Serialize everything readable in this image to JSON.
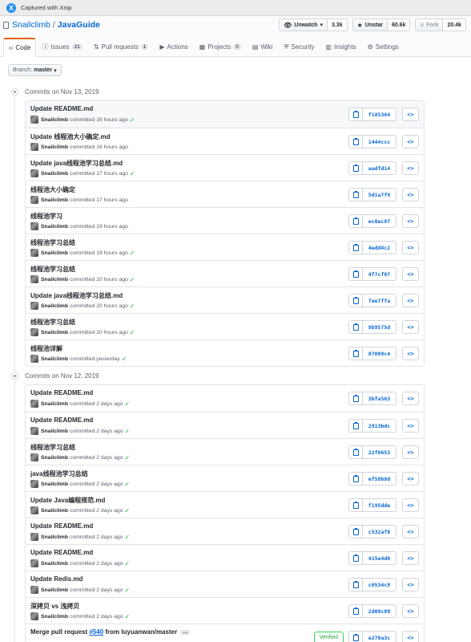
{
  "xnip": {
    "text": "Captured with Xnip",
    "logo": "X"
  },
  "repo": {
    "owner": "Snailclimb",
    "separator": "/",
    "name": "JavaGuide"
  },
  "actions": {
    "watch": {
      "label": "Unwatch",
      "count": "3.3k"
    },
    "star": {
      "label": "Unstar",
      "count": "60.6k"
    },
    "fork": {
      "label": "Fork",
      "count": "20.4k"
    }
  },
  "tabs": [
    {
      "label": "Code",
      "icon": "code-icon"
    },
    {
      "label": "Issues",
      "count": "21",
      "icon": "issue-icon"
    },
    {
      "label": "Pull requests",
      "count": "1",
      "icon": "pull-request-icon"
    },
    {
      "label": "Actions",
      "icon": "play-icon"
    },
    {
      "label": "Projects",
      "count": "0",
      "icon": "project-icon"
    },
    {
      "label": "Wiki",
      "icon": "book-icon"
    },
    {
      "label": "Security",
      "icon": "shield-icon"
    },
    {
      "label": "Insights",
      "icon": "graph-icon"
    },
    {
      "label": "Settings",
      "icon": "gear-icon"
    }
  ],
  "branch": {
    "label": "Branch:",
    "value": "master"
  },
  "groups": [
    {
      "title": "Commits on Nov 13, 2019",
      "commits": [
        {
          "title": "Update README.md",
          "author": "Snailclimb",
          "time": "committed 16 hours ago",
          "verified": true,
          "sha": "f185364"
        },
        {
          "title": "Update 线程池大小确定.md",
          "author": "Snailclimb",
          "time": "committed 16 hours ago",
          "verified": false,
          "sha": "1444ccc"
        },
        {
          "title": "Update java线程池学习总结.md",
          "author": "Snailclimb",
          "time": "committed 17 hours ago",
          "verified": true,
          "sha": "aadfd14"
        },
        {
          "title": "线程池大小确定",
          "author": "Snailclimb",
          "time": "committed 17 hours ago",
          "verified": false,
          "sha": "5d1a7f9"
        },
        {
          "title": "线程池学习",
          "author": "Snailclimb",
          "time": "committed 19 hours ago",
          "verified": false,
          "sha": "ec0ec87"
        },
        {
          "title": "线程池学习总结",
          "author": "Snailclimb",
          "time": "committed 19 hours ago",
          "verified": true,
          "sha": "4edd4c2"
        },
        {
          "title": "线程池学习总结",
          "author": "Snailclimb",
          "time": "committed 20 hours ago",
          "verified": true,
          "sha": "4f7cf07"
        },
        {
          "title": "Update java线程池学习总结.md",
          "author": "Snailclimb",
          "time": "committed 20 hours ago",
          "verified": true,
          "sha": "7ee7ffa"
        },
        {
          "title": "线程池学习总结",
          "author": "Snailclimb",
          "time": "committed 20 hours ago",
          "verified": true,
          "sha": "9b9575d"
        },
        {
          "title": "线程池详解",
          "author": "Snailclimb",
          "time": "committed yesterday",
          "verified": true,
          "sha": "87009c4"
        }
      ]
    },
    {
      "title": "Commits on Nov 12, 2019",
      "commits": [
        {
          "title": "Update README.md",
          "author": "Snailclimb",
          "time": "committed 2 days ago",
          "verified": true,
          "sha": "3bfa563"
        },
        {
          "title": "Update README.md",
          "author": "Snailclimb",
          "time": "committed 2 days ago",
          "verified": true,
          "sha": "2913bdc"
        },
        {
          "title": "线程池学习总结",
          "author": "Snailclimb",
          "time": "committed 2 days ago",
          "verified": true,
          "sha": "22f0653"
        },
        {
          "title": "java线程池学习总结",
          "author": "Snailclimb",
          "time": "committed 2 days ago",
          "verified": true,
          "sha": "ef58b8d"
        },
        {
          "title": "Update Java编程规范.md",
          "author": "Snailclimb",
          "time": "committed 2 days ago",
          "verified": true,
          "sha": "f195dde"
        },
        {
          "title": "Update README.md",
          "author": "Snailclimb",
          "time": "committed 2 days ago",
          "verified": true,
          "sha": "c532af8"
        },
        {
          "title": "Update README.md",
          "author": "Snailclimb",
          "time": "committed 2 days ago",
          "verified": true,
          "sha": "415e4d0"
        },
        {
          "title": "Update Redis.md",
          "author": "Snailclimb",
          "time": "committed 2 days ago",
          "verified": true,
          "sha": "c0534c9"
        },
        {
          "title": "深拷贝 vs 浅拷贝",
          "author": "Snailclimb",
          "time": "committed 2 days ago",
          "verified": true,
          "sha": "2d08c89"
        },
        {
          "title_prefix": "Merge pull request ",
          "pr_link": "#540",
          "title_suffix": " from luyuanwan/master",
          "author": "",
          "time": "",
          "verified": false,
          "badge": "Verified",
          "sha": "e270a3c"
        }
      ]
    }
  ],
  "browse_label": "<>",
  "colors": {
    "link": "#0366d6",
    "tab_accent": "#e36209",
    "success": "#28a745"
  }
}
